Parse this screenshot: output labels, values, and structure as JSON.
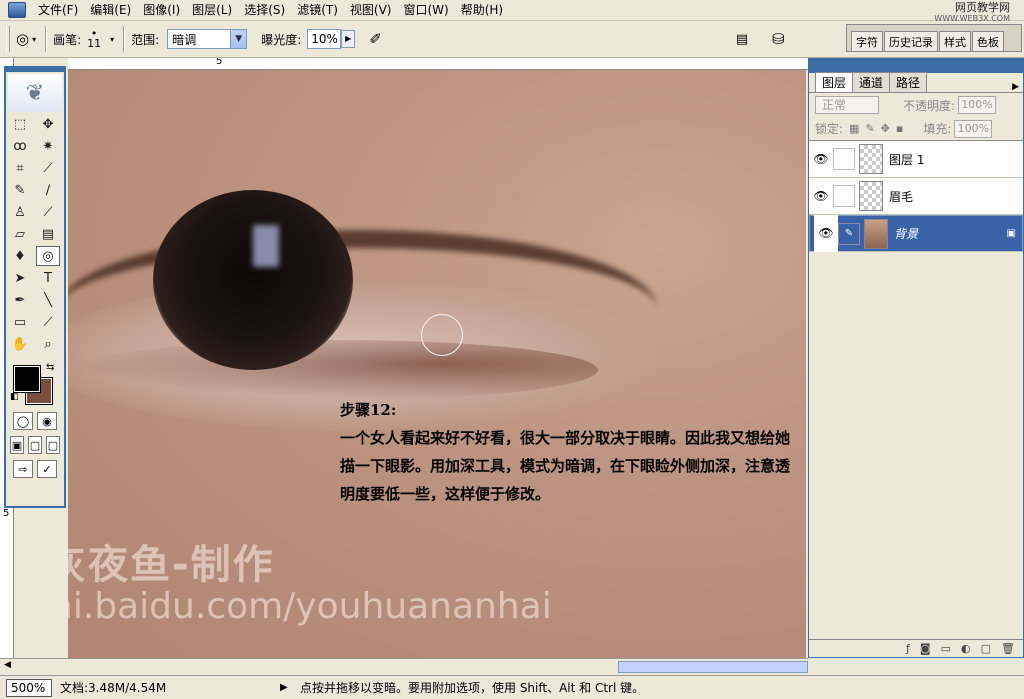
{
  "menu": [
    "文件(F)",
    "编辑(E)",
    "图像(I)",
    "图层(L)",
    "选择(S)",
    "滤镜(T)",
    "视图(V)",
    "窗口(W)",
    "帮助(H)"
  ],
  "watermark": {
    "title": "网页教学网",
    "url": "WWW.WEB3X.COM"
  },
  "options": {
    "brush_label": "画笔:",
    "brush_size": "11",
    "range_label": "范围:",
    "range_value": "暗调",
    "exposure_label": "曝光度:",
    "exposure_value": "10%"
  },
  "palette_well": [
    "字符",
    "历史记录",
    "样式",
    "色板"
  ],
  "ruler": {
    "h_mark": "5",
    "v_mark": "5"
  },
  "canvas": {
    "step_title": "步骤12:",
    "step_text": "一个女人看起来好不好看，很大一部分取决于眼睛。因此我又想给她描一下眼影。用加深工具，模式为暗调，在下眼睑外侧加深，注意透明度要低一些，这样便于修改。",
    "credit": "灰夜鱼-制作",
    "url": "hi.baidu.com/youhuananhai"
  },
  "tools": [
    {
      "name": "marquee",
      "glyph": "⬚"
    },
    {
      "name": "move",
      "glyph": "✥"
    },
    {
      "name": "lasso",
      "glyph": "ꝏ"
    },
    {
      "name": "magic-wand",
      "glyph": "✷"
    },
    {
      "name": "crop",
      "glyph": "⌗"
    },
    {
      "name": "slice",
      "glyph": "⟋"
    },
    {
      "name": "healing",
      "glyph": "✎"
    },
    {
      "name": "brush",
      "glyph": "∕"
    },
    {
      "name": "stamp",
      "glyph": "♙"
    },
    {
      "name": "history-brush",
      "glyph": "⟋"
    },
    {
      "name": "eraser",
      "glyph": "▱"
    },
    {
      "name": "gradient",
      "glyph": "▤"
    },
    {
      "name": "blur",
      "glyph": "♦"
    },
    {
      "name": "dodge-burn",
      "glyph": "◎"
    },
    {
      "name": "path-select",
      "glyph": "➤"
    },
    {
      "name": "type",
      "glyph": "T"
    },
    {
      "name": "pen",
      "glyph": "✒"
    },
    {
      "name": "line",
      "glyph": "╲"
    },
    {
      "name": "notes",
      "glyph": "▭"
    },
    {
      "name": "eyedropper",
      "glyph": "⟋"
    },
    {
      "name": "hand",
      "glyph": "✋"
    },
    {
      "name": "zoom",
      "glyph": "⌕"
    }
  ],
  "active_tool": "dodge-burn",
  "colors": {
    "foreground": "#000000",
    "background": "#7a4e3c"
  },
  "layers_panel": {
    "tabs": [
      "图层",
      "通道",
      "路径"
    ],
    "blend_mode": "正常",
    "opacity_label": "不透明度:",
    "opacity": "100%",
    "lock_label": "锁定:",
    "fill_label": "填充:",
    "fill": "100%",
    "layers": [
      {
        "name": "图层 1",
        "selected": false
      },
      {
        "name": "眉毛",
        "selected": false
      },
      {
        "name": "背景",
        "selected": true
      }
    ]
  },
  "status": {
    "zoom": "500%",
    "doc": "文档:3.48M/4.54M",
    "hint": "点按并拖移以变暗。要用附加选项，使用 Shift、Alt 和 Ctrl 键。"
  }
}
